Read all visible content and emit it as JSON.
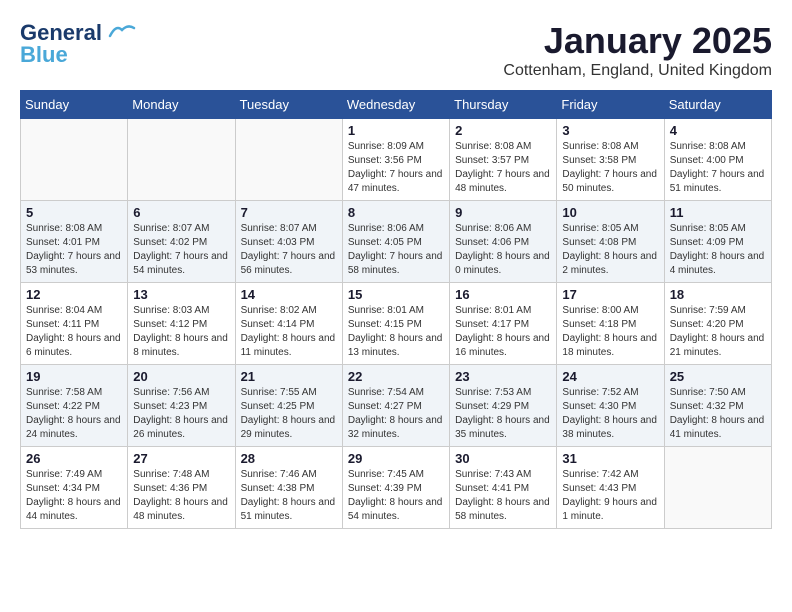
{
  "header": {
    "logo_line1": "General",
    "logo_line2": "Blue",
    "month": "January 2025",
    "location": "Cottenham, England, United Kingdom"
  },
  "weekdays": [
    "Sunday",
    "Monday",
    "Tuesday",
    "Wednesday",
    "Thursday",
    "Friday",
    "Saturday"
  ],
  "rows": [
    {
      "cells": [
        {
          "day": null
        },
        {
          "day": null
        },
        {
          "day": null
        },
        {
          "day": "1",
          "sunrise": "8:09 AM",
          "sunset": "3:56 PM",
          "daylight": "7 hours and 47 minutes."
        },
        {
          "day": "2",
          "sunrise": "8:08 AM",
          "sunset": "3:57 PM",
          "daylight": "7 hours and 48 minutes."
        },
        {
          "day": "3",
          "sunrise": "8:08 AM",
          "sunset": "3:58 PM",
          "daylight": "7 hours and 50 minutes."
        },
        {
          "day": "4",
          "sunrise": "8:08 AM",
          "sunset": "4:00 PM",
          "daylight": "7 hours and 51 minutes."
        }
      ]
    },
    {
      "cells": [
        {
          "day": "5",
          "sunrise": "8:08 AM",
          "sunset": "4:01 PM",
          "daylight": "7 hours and 53 minutes."
        },
        {
          "day": "6",
          "sunrise": "8:07 AM",
          "sunset": "4:02 PM",
          "daylight": "7 hours and 54 minutes."
        },
        {
          "day": "7",
          "sunrise": "8:07 AM",
          "sunset": "4:03 PM",
          "daylight": "7 hours and 56 minutes."
        },
        {
          "day": "8",
          "sunrise": "8:06 AM",
          "sunset": "4:05 PM",
          "daylight": "7 hours and 58 minutes."
        },
        {
          "day": "9",
          "sunrise": "8:06 AM",
          "sunset": "4:06 PM",
          "daylight": "8 hours and 0 minutes."
        },
        {
          "day": "10",
          "sunrise": "8:05 AM",
          "sunset": "4:08 PM",
          "daylight": "8 hours and 2 minutes."
        },
        {
          "day": "11",
          "sunrise": "8:05 AM",
          "sunset": "4:09 PM",
          "daylight": "8 hours and 4 minutes."
        }
      ]
    },
    {
      "cells": [
        {
          "day": "12",
          "sunrise": "8:04 AM",
          "sunset": "4:11 PM",
          "daylight": "8 hours and 6 minutes."
        },
        {
          "day": "13",
          "sunrise": "8:03 AM",
          "sunset": "4:12 PM",
          "daylight": "8 hours and 8 minutes."
        },
        {
          "day": "14",
          "sunrise": "8:02 AM",
          "sunset": "4:14 PM",
          "daylight": "8 hours and 11 minutes."
        },
        {
          "day": "15",
          "sunrise": "8:01 AM",
          "sunset": "4:15 PM",
          "daylight": "8 hours and 13 minutes."
        },
        {
          "day": "16",
          "sunrise": "8:01 AM",
          "sunset": "4:17 PM",
          "daylight": "8 hours and 16 minutes."
        },
        {
          "day": "17",
          "sunrise": "8:00 AM",
          "sunset": "4:18 PM",
          "daylight": "8 hours and 18 minutes."
        },
        {
          "day": "18",
          "sunrise": "7:59 AM",
          "sunset": "4:20 PM",
          "daylight": "8 hours and 21 minutes."
        }
      ]
    },
    {
      "cells": [
        {
          "day": "19",
          "sunrise": "7:58 AM",
          "sunset": "4:22 PM",
          "daylight": "8 hours and 24 minutes."
        },
        {
          "day": "20",
          "sunrise": "7:56 AM",
          "sunset": "4:23 PM",
          "daylight": "8 hours and 26 minutes."
        },
        {
          "day": "21",
          "sunrise": "7:55 AM",
          "sunset": "4:25 PM",
          "daylight": "8 hours and 29 minutes."
        },
        {
          "day": "22",
          "sunrise": "7:54 AM",
          "sunset": "4:27 PM",
          "daylight": "8 hours and 32 minutes."
        },
        {
          "day": "23",
          "sunrise": "7:53 AM",
          "sunset": "4:29 PM",
          "daylight": "8 hours and 35 minutes."
        },
        {
          "day": "24",
          "sunrise": "7:52 AM",
          "sunset": "4:30 PM",
          "daylight": "8 hours and 38 minutes."
        },
        {
          "day": "25",
          "sunrise": "7:50 AM",
          "sunset": "4:32 PM",
          "daylight": "8 hours and 41 minutes."
        }
      ]
    },
    {
      "cells": [
        {
          "day": "26",
          "sunrise": "7:49 AM",
          "sunset": "4:34 PM",
          "daylight": "8 hours and 44 minutes."
        },
        {
          "day": "27",
          "sunrise": "7:48 AM",
          "sunset": "4:36 PM",
          "daylight": "8 hours and 48 minutes."
        },
        {
          "day": "28",
          "sunrise": "7:46 AM",
          "sunset": "4:38 PM",
          "daylight": "8 hours and 51 minutes."
        },
        {
          "day": "29",
          "sunrise": "7:45 AM",
          "sunset": "4:39 PM",
          "daylight": "8 hours and 54 minutes."
        },
        {
          "day": "30",
          "sunrise": "7:43 AM",
          "sunset": "4:41 PM",
          "daylight": "8 hours and 58 minutes."
        },
        {
          "day": "31",
          "sunrise": "7:42 AM",
          "sunset": "4:43 PM",
          "daylight": "9 hours and 1 minute."
        },
        {
          "day": null
        }
      ]
    }
  ]
}
